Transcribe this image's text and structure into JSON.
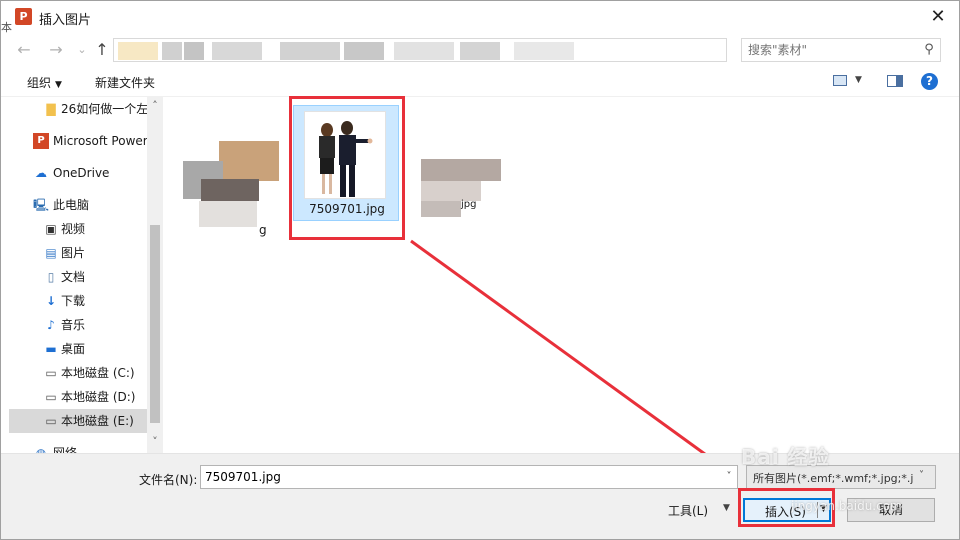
{
  "window": {
    "app_icon": "P",
    "title": "插入图片",
    "close": "✕",
    "edge_char": "本"
  },
  "address_bar": {
    "back_icon": "←",
    "forward_icon": "→",
    "recent_icon": "⌄",
    "up_icon": "↑",
    "dropdown_icon": "⌄",
    "refresh_icon": "↻",
    "search_placeholder": "搜索\"素材\"",
    "search_icon": "⚲"
  },
  "toolbar": {
    "organize": "组织",
    "new_folder": "新建文件夹",
    "help": "?"
  },
  "nav_pane": {
    "items": [
      {
        "label": "26如何做一个左",
        "icon": "folder"
      },
      {
        "label": "Microsoft Power",
        "icon": "powerpoint"
      },
      {
        "label": "OneDrive",
        "icon": "cloud"
      },
      {
        "label": "此电脑",
        "icon": "computer"
      },
      {
        "label": "视频",
        "icon": "video"
      },
      {
        "label": "图片",
        "icon": "pictures"
      },
      {
        "label": "文档",
        "icon": "documents"
      },
      {
        "label": "下载",
        "icon": "download"
      },
      {
        "label": "音乐",
        "icon": "music"
      },
      {
        "label": "桌面",
        "icon": "desktop"
      },
      {
        "label": "本地磁盘 (C:)",
        "icon": "drive"
      },
      {
        "label": "本地磁盘 (D:)",
        "icon": "drive"
      },
      {
        "label": "本地磁盘 (E:)",
        "icon": "drive"
      },
      {
        "label": "网络",
        "icon": "network"
      }
    ],
    "scroll_up": "˄",
    "scroll_down": "˅"
  },
  "files": {
    "left_name": "g",
    "selected_name": "7509701.jpg",
    "right_name": "jpg"
  },
  "bottom": {
    "filename_label": "文件名(N):",
    "filename_value": "7509701.jpg",
    "filetype": "所有图片(*.emf;*.wmf;*.jpg;*.j",
    "tools": "工具(L)",
    "insert": "插入(S)",
    "cancel": "取消"
  },
  "watermark": {
    "main": "Bai 经验",
    "sub": "jingyan.baidu.com"
  },
  "colors": {
    "accent": "#0078d7",
    "annotation_red": "#e8303a",
    "selection": "#cce8ff"
  }
}
